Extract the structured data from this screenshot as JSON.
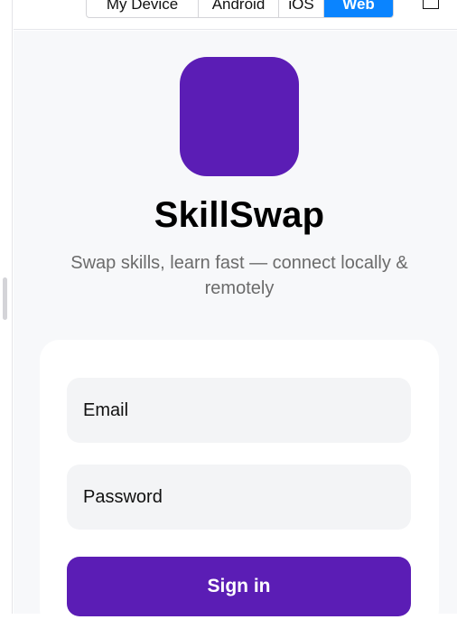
{
  "toolbar": {
    "platforms": [
      {
        "label": "My Device",
        "selected": false
      },
      {
        "label": "Android",
        "selected": false
      },
      {
        "label": "iOS",
        "selected": false
      },
      {
        "label": "Web",
        "selected": true
      }
    ],
    "selected_color": "#0a84ff",
    "window_icon": "window-icon"
  },
  "app": {
    "logo_color": "#5b1db5",
    "title": "SkillSwap",
    "subtitle": "Swap skills, learn fast — connect locally & remotely"
  },
  "login": {
    "email_placeholder": "Email",
    "password_placeholder": "Password",
    "signin_label": "Sign in",
    "button_color": "#5b1db5"
  }
}
